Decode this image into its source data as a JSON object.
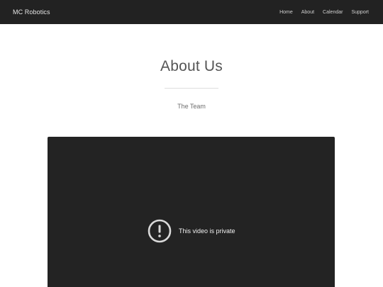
{
  "navbar": {
    "brand": "MC Robotics",
    "links": [
      {
        "label": "Home"
      },
      {
        "label": "About"
      },
      {
        "label": "Calendar"
      },
      {
        "label": "Support"
      }
    ]
  },
  "main": {
    "title": "About Us",
    "subtitle": "The Team"
  },
  "video": {
    "message": "This video is private",
    "icon": "alert-circle-icon"
  },
  "colors": {
    "navbar_bg": "#222222",
    "video_bg": "#232323",
    "page_bg": "#ffffff"
  }
}
